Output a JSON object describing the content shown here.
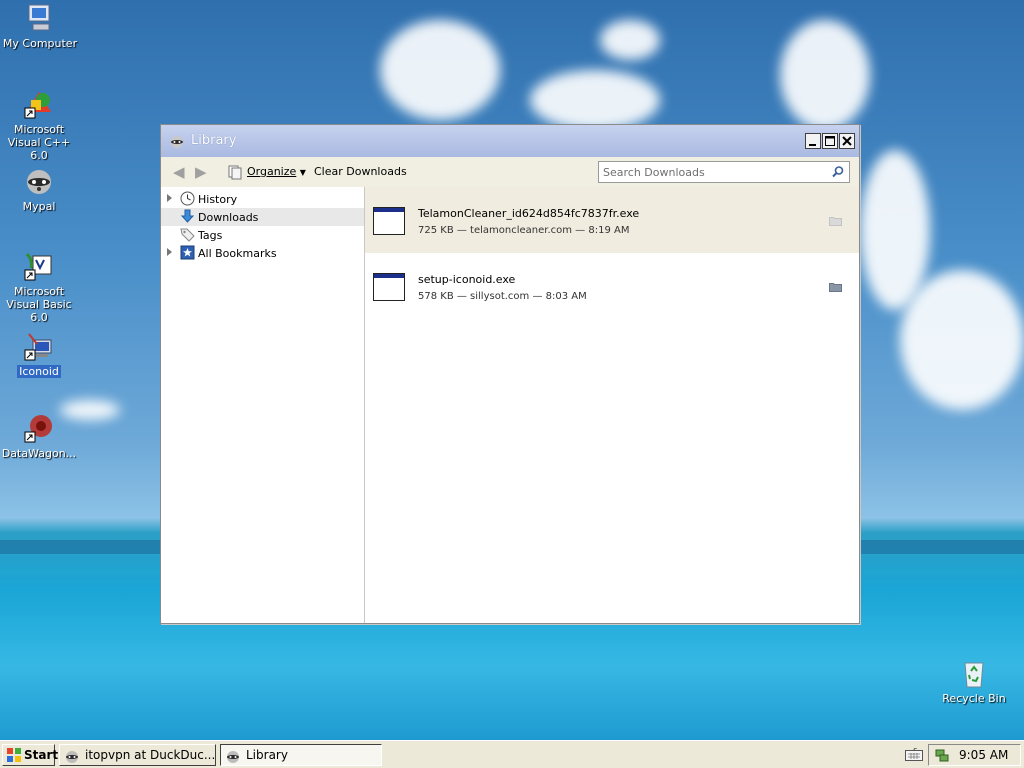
{
  "desktop": {
    "icons": [
      {
        "label": "My Computer"
      },
      {
        "label": "Microsoft Visual C++ 6.0"
      },
      {
        "label": "Mypal"
      },
      {
        "label": "Microsoft Visual Basic 6.0"
      },
      {
        "label": "Iconoid"
      },
      {
        "label": "DataWagon..."
      },
      {
        "label": "Recycle Bin"
      }
    ]
  },
  "window": {
    "title": "Library",
    "controls": {
      "minimize": "_",
      "maximize": "□",
      "close": "✕"
    },
    "toolbar": {
      "back_icon": "◀",
      "forward_icon": "▶",
      "organize_label": "Organize",
      "clear_label": "Clear Downloads",
      "search_placeholder": "Search Downloads"
    },
    "sidebar": {
      "items": [
        {
          "label": "History"
        },
        {
          "label": "Downloads"
        },
        {
          "label": "Tags"
        },
        {
          "label": "All Bookmarks"
        }
      ]
    },
    "downloads": [
      {
        "name": "TelamonCleaner_id624d854fc7837fr.exe",
        "info": "725 KB — telamoncleaner.com — 8:19 AM"
      },
      {
        "name": "setup-iconoid.exe",
        "info": "578 KB — sillysot.com — 8:03 AM"
      }
    ]
  },
  "taskbar": {
    "start_label": "Start",
    "tasks": [
      {
        "label": "itopvpn at DuckDuc..."
      },
      {
        "label": "Library"
      }
    ],
    "clock": "9:05 AM"
  },
  "colors": {
    "titlebar": "#aab9e2",
    "selection": "#316ac5",
    "taskbar": "#ece9d8"
  }
}
